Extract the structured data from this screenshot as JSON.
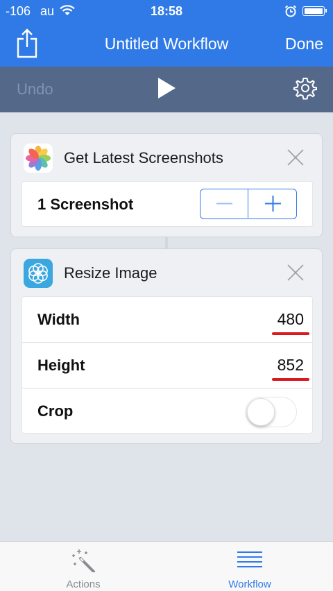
{
  "status_bar": {
    "signal": "-106",
    "carrier": "au",
    "time": "18:58"
  },
  "nav": {
    "title": "Untitled Workflow",
    "done_label": "Done"
  },
  "toolbar": {
    "undo_label": "Undo"
  },
  "actions": [
    {
      "title": "Get Latest Screenshots",
      "icon": "photos-icon",
      "count_label": "1 Screenshot"
    },
    {
      "title": "Resize Image",
      "icon": "resize-image-icon",
      "fields": [
        {
          "label": "Width",
          "value": "480"
        },
        {
          "label": "Height",
          "value": "852"
        },
        {
          "label": "Crop",
          "toggle": false
        }
      ]
    }
  ],
  "tabs": [
    {
      "label": "Actions",
      "icon": "magic-wand-icon",
      "active": false
    },
    {
      "label": "Workflow",
      "icon": "list-icon",
      "active": true
    }
  ],
  "colors": {
    "accent": "#2f7ae6",
    "toolbar": "#54688a",
    "highlight_underline": "#d9191d"
  }
}
